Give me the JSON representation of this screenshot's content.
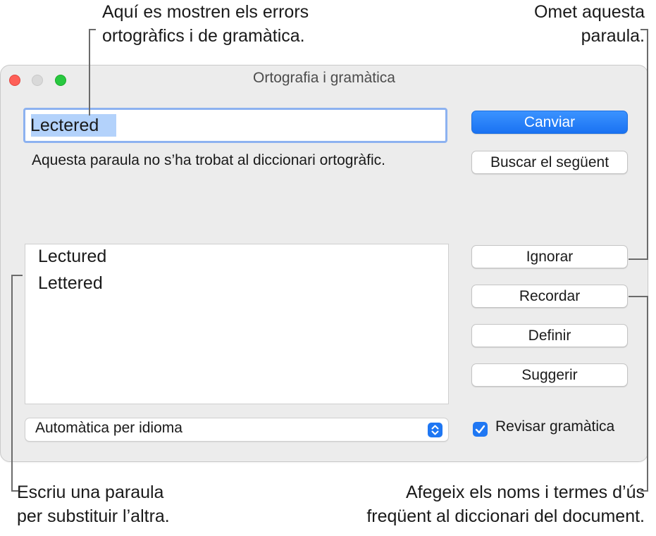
{
  "callouts": {
    "top_left": [
      "Aquí es mostren els errors",
      "ortogràfics i de gramàtica."
    ],
    "top_right": [
      "Omet aquesta",
      "paraula."
    ],
    "bottom_left": [
      "Escriu una paraula",
      "per substituir l’altra."
    ],
    "bottom_right": [
      "Afegeix els noms i termes d’ús",
      "freqüent al diccionari del document."
    ]
  },
  "window": {
    "title": "Ortografia i gramàtica"
  },
  "word_field": {
    "value": "Lectered"
  },
  "message": "Aquesta paraula no s’ha trobat al diccionari ortogràfic.",
  "buttons": {
    "change": "Canviar",
    "find_next": "Buscar el següent",
    "ignore": "Ignorar",
    "learn": "Recordar",
    "define": "Definir",
    "guess": "Suggerir"
  },
  "suggestions": [
    "Lectured",
    "Lettered"
  ],
  "language_popup": {
    "selected": "Automàtica per idioma"
  },
  "check_grammar": {
    "label": "Revisar gramàtica",
    "checked": true
  },
  "colors": {
    "accent": "#1f77f3",
    "focus_ring": "#8db2f0",
    "selection": "#b3d2fb",
    "window_bg": "#ececec"
  },
  "icons": [
    "close-window-icon",
    "minimize-window-icon",
    "zoom-window-icon",
    "popup-arrows-icon",
    "checkmark-icon"
  ]
}
